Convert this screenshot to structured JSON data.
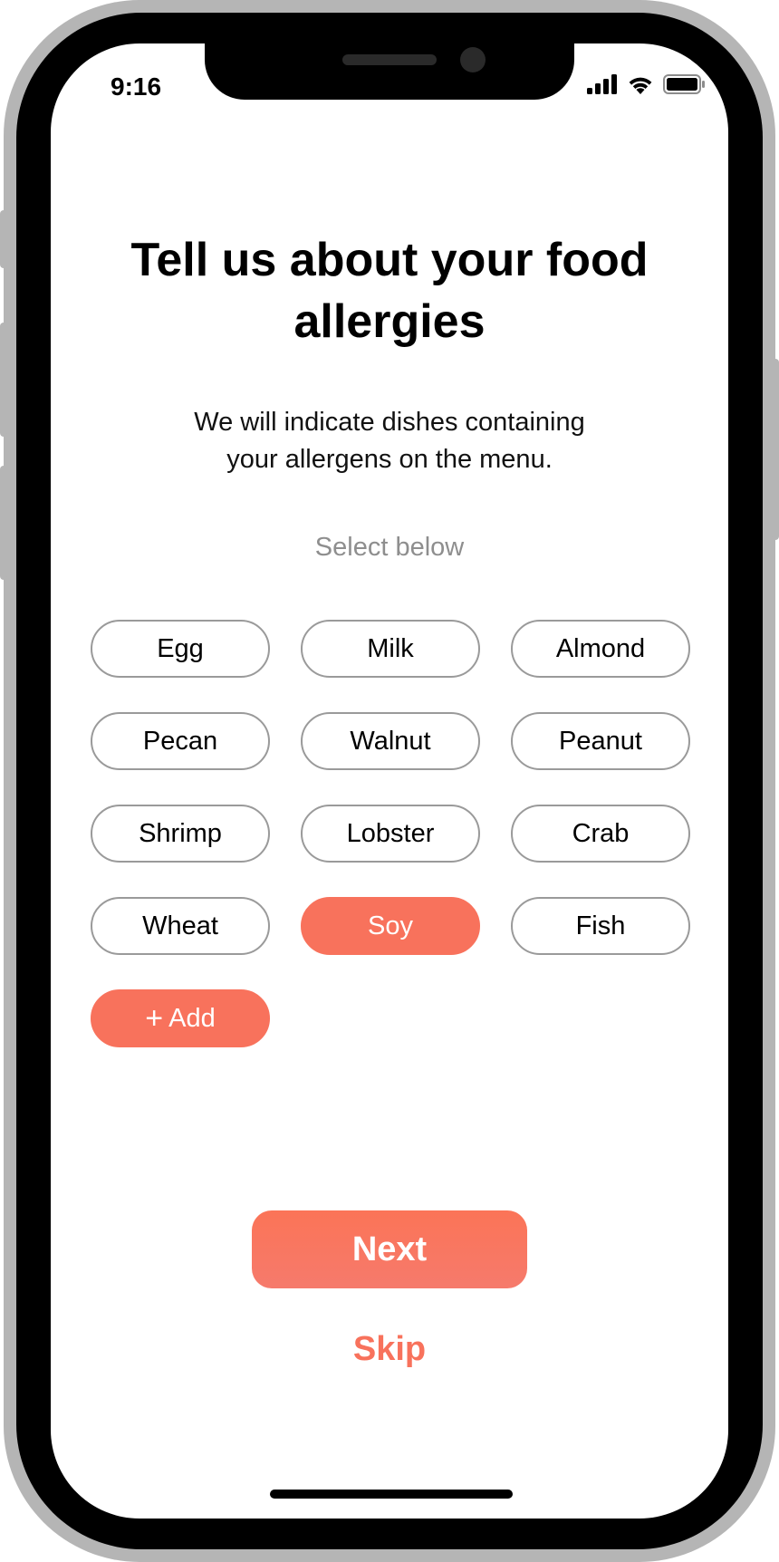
{
  "status_bar": {
    "time": "9:16"
  },
  "screen": {
    "title": "Tell us about your food allergies",
    "subtitle": "We will indicate dishes containing your allergens on the menu.",
    "hint": "Select below"
  },
  "allergens": [
    {
      "label": "Egg",
      "selected": false
    },
    {
      "label": "Milk",
      "selected": false
    },
    {
      "label": "Almond",
      "selected": false
    },
    {
      "label": "Pecan",
      "selected": false
    },
    {
      "label": "Walnut",
      "selected": false
    },
    {
      "label": "Peanut",
      "selected": false
    },
    {
      "label": "Shrimp",
      "selected": false
    },
    {
      "label": "Lobster",
      "selected": false
    },
    {
      "label": "Crab",
      "selected": false
    },
    {
      "label": "Wheat",
      "selected": false
    },
    {
      "label": "Soy",
      "selected": true
    },
    {
      "label": "Fish",
      "selected": false
    }
  ],
  "add_chip": {
    "plus": "+",
    "label": "Add"
  },
  "actions": {
    "next_label": "Next",
    "skip_label": "Skip"
  },
  "colors": {
    "accent": "#f8725c",
    "hint_gray": "#8e8e8e",
    "chip_border": "#9a9a9a"
  },
  "icons": {
    "status": [
      "cellular-signal-icon",
      "wifi-icon",
      "battery-icon"
    ],
    "add": "plus-icon"
  }
}
